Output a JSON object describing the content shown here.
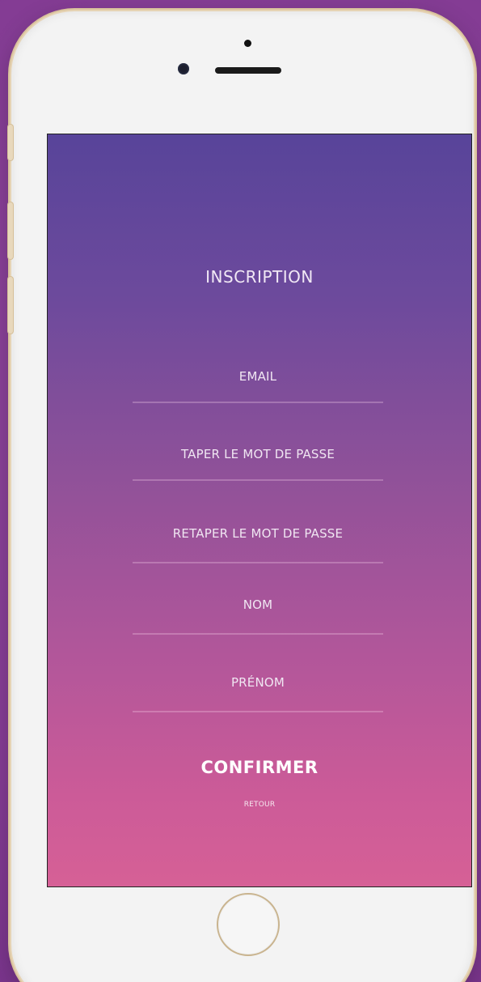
{
  "screen": {
    "title": "INSCRIPTION",
    "fields": [
      {
        "label": "EMAIL"
      },
      {
        "label": "TAPER LE MOT DE PASSE"
      },
      {
        "label": "RETAPER LE MOT DE PASSE"
      },
      {
        "label": "NOM"
      },
      {
        "label": "PRÉNOM"
      }
    ],
    "confirm_label": "CONFIRMER",
    "back_label": "RETOUR"
  },
  "colors": {
    "background": "#8a3f97",
    "gradient_top": "#58449a",
    "gradient_bottom": "#d66096",
    "text": "#ffffff"
  }
}
